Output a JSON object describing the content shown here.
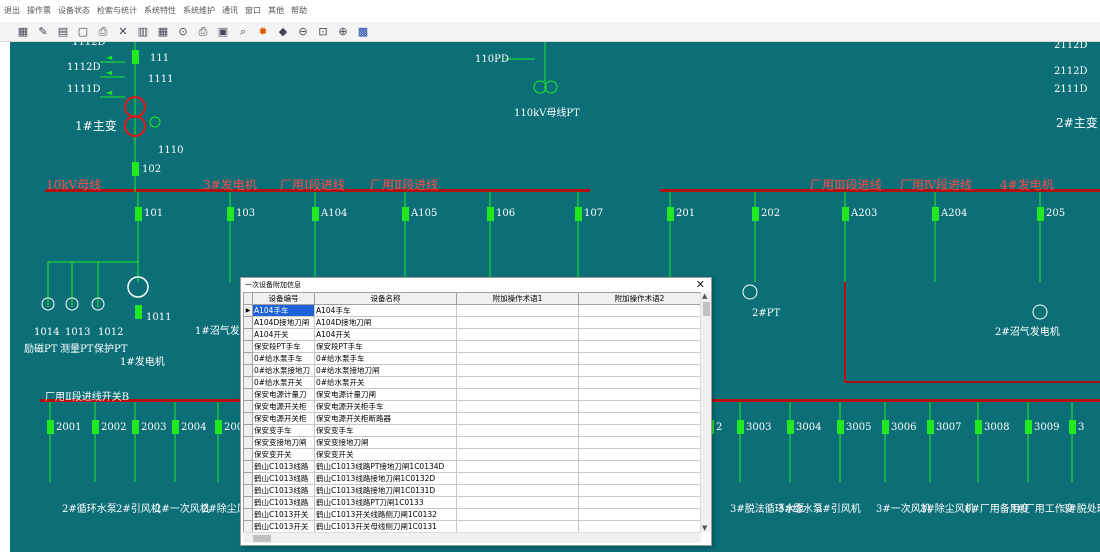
{
  "menu": [
    "退出",
    "操作票",
    "设备状态",
    "检索与统计",
    "系统特性",
    "系统维护",
    "通讯",
    "窗口",
    "其他",
    "帮助"
  ],
  "toolbar_icons": [
    "grid-icon",
    "chart-icon",
    "layers-icon",
    "new-file-icon",
    "print-icon",
    "delete-icon",
    "list-icon",
    "table-icon",
    "copy-icon",
    "printer-icon",
    "export-icon",
    "search-icon",
    "flame-icon",
    "diamond-icon",
    "zoom-out-icon",
    "zoom-fit-icon",
    "zoom-icon",
    "map-icon"
  ],
  "diagram": {
    "top_left": [
      "1112D",
      "1111",
      "1111D",
      "111",
      "1110",
      "1#主变",
      "102",
      "1112D"
    ],
    "top_center": [
      "110PD",
      "110kV母线PT"
    ],
    "top_right": [
      "2112D",
      "2111D",
      "2#主变",
      "2112D"
    ],
    "bus1_labels": [
      "10kV母线",
      "3#发电机",
      "厂用Ⅰ段进线",
      "厂用Ⅱ段进线"
    ],
    "bus2_labels": [
      "厂用Ⅲ段进线",
      "厂用Ⅳ段进线",
      "4#发电机"
    ],
    "feeders_left": [
      "101",
      "103",
      "A104",
      "A105",
      "106",
      "107"
    ],
    "feeders_right": [
      "201",
      "202",
      "A203",
      "A204",
      "205"
    ],
    "left_equipment": [
      "1014",
      "1013",
      "1012",
      "1011",
      "励磁PT",
      "测量PT",
      "保护PT",
      "1#发电机",
      "1#沼气发电"
    ],
    "right_equipment": [
      "2#PT",
      "2#沼气发电机"
    ],
    "lower_bus_label": "厂用Ⅱ段进线开关B",
    "lower_left_switches": [
      "2001",
      "2002",
      "2003",
      "2004",
      "2005"
    ],
    "lower_right_switches": [
      "2",
      "3003",
      "3004",
      "3005",
      "3006",
      "3007",
      "3008",
      "3009",
      "3"
    ],
    "lower_left_loads": [
      "2#循环水泵",
      "2#引风机",
      "2#一次风机",
      "2#除尘风"
    ],
    "lower_right_loads": [
      "3#脱法循环水泵",
      "3#给水泵",
      "3#引风机",
      "3#一次风机",
      "3#除尘风机",
      "0#厂用备用变",
      "3#厂用工作变",
      "3#脱处理"
    ]
  },
  "dialog": {
    "title": "一次设备附加信息",
    "columns": [
      "设备编号",
      "设备名称",
      "附加操作术语1",
      "附加操作术语2"
    ],
    "rows": [
      [
        "A104手车",
        "A104手车"
      ],
      [
        "A104D接地刀闸",
        "A104D接地刀闸"
      ],
      [
        "A104开关",
        "A104开关"
      ],
      [
        "保安段PT手车",
        "保安段PT手车"
      ],
      [
        "0#给水泵手车",
        "0#给水泵手车"
      ],
      [
        "0#给水泵接地刀",
        "0#给水泵接地刀闸"
      ],
      [
        "0#给水泵开关",
        "0#给水泵开关"
      ],
      [
        "保安电源计量刀",
        "保安电源计量刀闸"
      ],
      [
        "保安电源开关柜",
        "保安电源开关柜手车"
      ],
      [
        "保安电源开关柜",
        "保安电源开关柜断路器"
      ],
      [
        "保安变手车",
        "保安变手车"
      ],
      [
        "保安变接地刀闸",
        "保安变接地刀闸"
      ],
      [
        "保安变开关",
        "保安变开关"
      ],
      [
        "鹤山C1013线路",
        "鹤山C1013线路PT接地刀闸1C0134D"
      ],
      [
        "鹤山C1013线路",
        "鹤山C1013线路接地刀闸1C0132D"
      ],
      [
        "鹤山C1013线路",
        "鹤山C1013线路接地刀闸1C0131D"
      ],
      [
        "鹤山C1013线路",
        "鹤山C1013线路PT刀闸1C0133"
      ],
      [
        "鹤山C1013开关",
        "鹤山C1013开关线路侧刀闸1C0132"
      ],
      [
        "鹤山C1013开关",
        "鹤山C1013开关母线侧刀闸1C0131"
      ]
    ]
  },
  "colors": {
    "background": "#0c6f78",
    "bus": "#b01010",
    "breaker": "#22e822",
    "transformer": "#dd1818"
  }
}
